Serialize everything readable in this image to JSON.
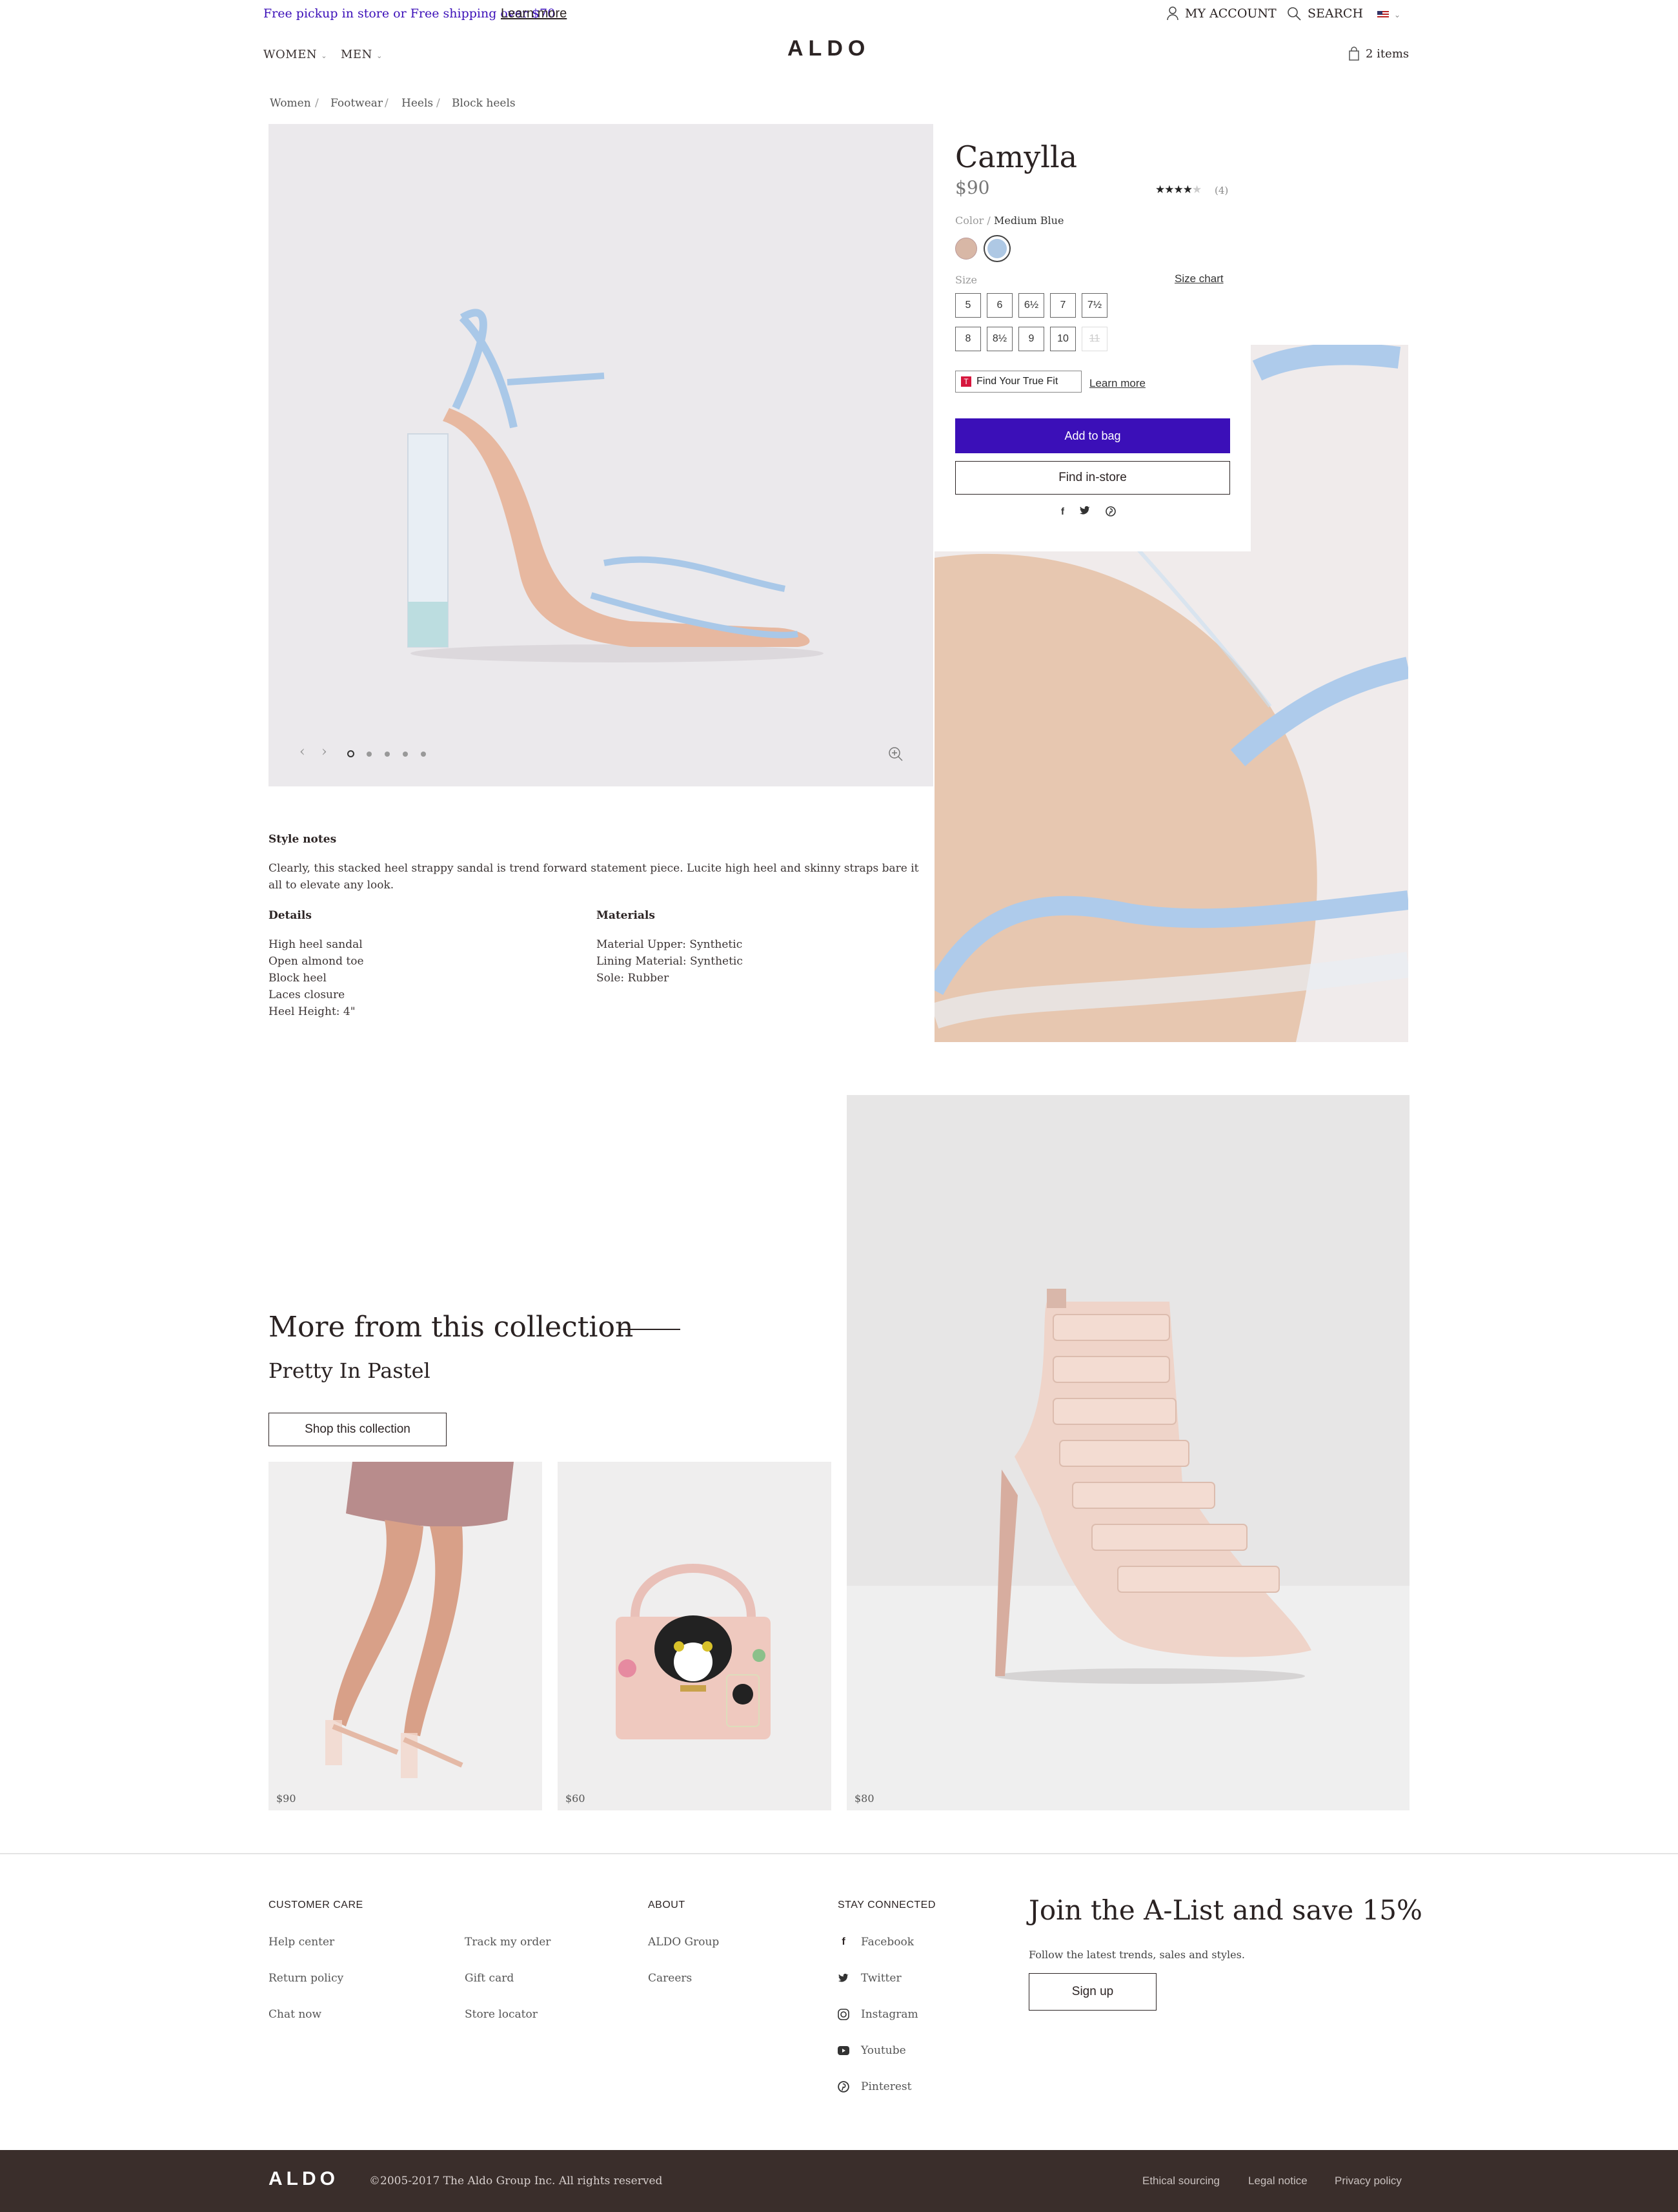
{
  "topbar": {
    "promo_text": "Free pickup in store or Free shipping over $70",
    "promo_link": "Learn more",
    "account": "MY ACCOUNT",
    "search": "SEARCH"
  },
  "nav": {
    "logo": "ALDO",
    "women": "WOMEN",
    "men": "MEN",
    "bag": "2 items"
  },
  "breadcrumb": [
    "Women",
    "Footwear",
    "Heels",
    "Block heels"
  ],
  "product": {
    "name": "Camylla",
    "price": "$90",
    "rating_count": "(4)",
    "rating": 4,
    "color_label": "Color /",
    "color_value": "Medium Blue",
    "swatches": [
      "#d8b7a6",
      "#aec8e4"
    ],
    "size_label": "Size",
    "size_chart": "Size chart",
    "sizes": [
      "5",
      "6",
      "6½",
      "7",
      "7½",
      "8",
      "8½",
      "9",
      "10",
      "11"
    ],
    "true_fit": "Find Your True Fit",
    "true_fit_link": "Learn more",
    "add_to_bag": "Add to bag",
    "find_in_store": "Find in-store"
  },
  "style_notes": {
    "heading": "Style notes",
    "text": "Clearly, this stacked heel strappy sandal is trend forward statement piece. Lucite high heel and skinny straps bare it all to elevate any look.",
    "details_heading": "Details",
    "details": [
      "High heel sandal",
      "Open almond toe",
      "Block heel",
      "Laces closure",
      "Heel Height: 4\""
    ],
    "materials_heading": "Materials",
    "materials": [
      "Material Upper: Synthetic",
      "Lining Material: Synthetic",
      "Sole: Rubber"
    ]
  },
  "collection": {
    "heading": "More from this collection",
    "subheading": "Pretty In Pastel",
    "button": "Shop this collection",
    "prices": [
      "$90",
      "$60",
      "$80"
    ]
  },
  "footer": {
    "customer_care": "CUSTOMER CARE",
    "care_links": [
      "Help center",
      "Return policy",
      "Chat now"
    ],
    "care_links2": [
      "Track my order",
      "Gift card",
      "Store locator"
    ],
    "about": "ABOUT",
    "about_links": [
      "ALDO Group",
      "Careers"
    ],
    "stay_connected": "STAY CONNECTED",
    "social": [
      "Facebook",
      "Twitter",
      "Instagram",
      "Youtube",
      "Pinterest"
    ],
    "alist_heading": "Join the A-List and save 15%",
    "alist_text": "Follow the latest trends, sales and styles.",
    "signup": "Sign up"
  },
  "bottom": {
    "logo": "ALDO",
    "copyright": "©2005-2017 The Aldo Group Inc. All rights reserved",
    "links": [
      "Ethical sourcing",
      "Legal notice",
      "Privacy policy"
    ]
  },
  "colors": {
    "accent": "#3b0fb8",
    "dark": "#3a2e2b"
  }
}
